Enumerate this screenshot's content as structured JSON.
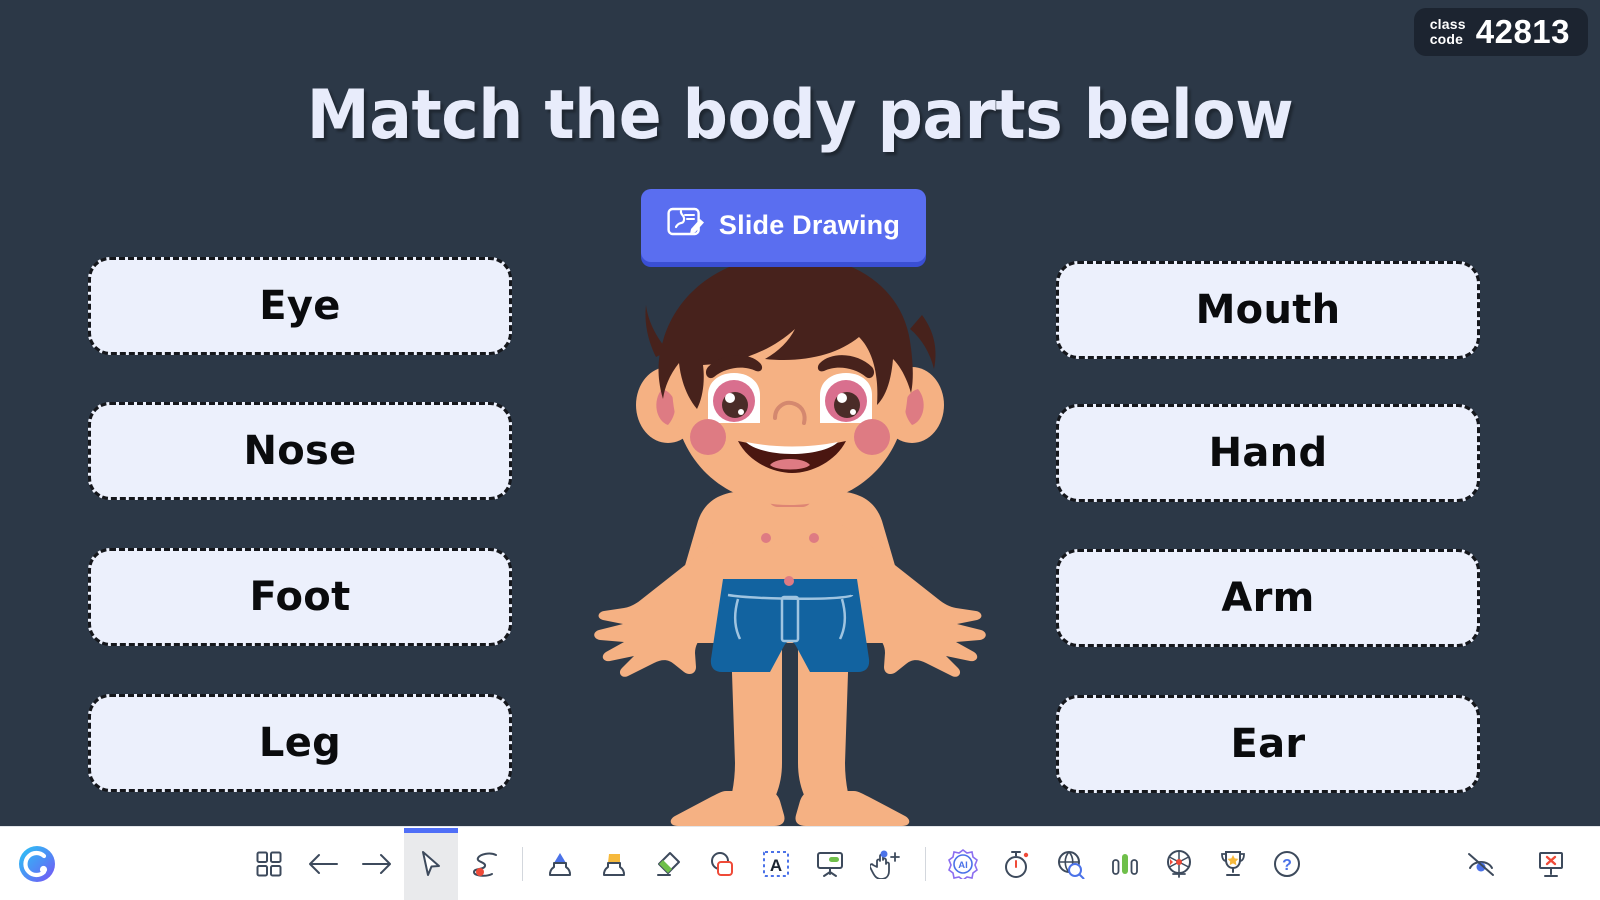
{
  "app": {
    "name": "ClassPoint",
    "background_color": "#2c3847",
    "accent_color": "#5a6ef0",
    "card_fill_color": "#ecf0fc",
    "toolbar_background": "#ffffff"
  },
  "class_code": {
    "label_line1": "class",
    "label_line2": "code",
    "value": "42813"
  },
  "slide": {
    "title": "Match the body parts below"
  },
  "slide_drawing_button": {
    "label": "Slide Drawing",
    "icon": "slide-drawing-icon"
  },
  "cards": {
    "left_column": [
      {
        "label": "Eye"
      },
      {
        "label": "Nose"
      },
      {
        "label": "Foot"
      },
      {
        "label": "Leg"
      }
    ],
    "right_column": [
      {
        "label": "Mouth"
      },
      {
        "label": "Hand"
      },
      {
        "label": "Arm"
      },
      {
        "label": "Ear"
      }
    ]
  },
  "illustration": {
    "name": "cartoon-boy-body",
    "skin_color": "#f5b183",
    "hair_color": "#47221c",
    "shorts_color": "#1263a0",
    "cheek_color": "#e0767f",
    "eye_color": "#d96f8e"
  },
  "toolbar": {
    "logo": "classpoint-logo",
    "tools": [
      {
        "name": "slide-grid-icon",
        "tooltip": "Slide Overview",
        "selected": false
      },
      {
        "name": "arrow-left-icon",
        "tooltip": "Previous Slide",
        "selected": false
      },
      {
        "name": "arrow-right-icon",
        "tooltip": "Next Slide",
        "selected": false
      },
      {
        "name": "cursor-icon",
        "tooltip": "Select",
        "selected": true
      },
      {
        "name": "laser-pointer-icon",
        "tooltip": "Laser Pointer",
        "selected": false
      },
      {
        "name": "pen-icon",
        "tooltip": "Pen",
        "selected": false
      },
      {
        "name": "highlighter-icon",
        "tooltip": "Highlighter",
        "selected": false
      },
      {
        "name": "eraser-icon",
        "tooltip": "Eraser",
        "selected": false
      },
      {
        "name": "shapes-icon",
        "tooltip": "Shapes",
        "selected": false
      },
      {
        "name": "text-box-icon",
        "tooltip": "Text Box",
        "selected": false
      },
      {
        "name": "whiteboard-icon",
        "tooltip": "Whiteboard",
        "selected": false
      },
      {
        "name": "drag-objects-icon",
        "tooltip": "Drag Objects",
        "selected": false
      },
      {
        "name": "ai-icon",
        "tooltip": "AI Assistant",
        "selected": false
      },
      {
        "name": "timer-icon",
        "tooltip": "Timer",
        "selected": false
      },
      {
        "name": "browser-icon",
        "tooltip": "Embedded Browser",
        "selected": false
      },
      {
        "name": "bar-chart-icon",
        "tooltip": "Quick Poll",
        "selected": false
      },
      {
        "name": "name-picker-icon",
        "tooltip": "Name Picker",
        "selected": false
      },
      {
        "name": "leaderboard-icon",
        "tooltip": "Leaderboard",
        "selected": false
      },
      {
        "name": "help-icon",
        "tooltip": "Help",
        "selected": false
      }
    ],
    "right_tools": [
      {
        "name": "hide-toolbar-icon",
        "tooltip": "Hide Toolbar"
      },
      {
        "name": "exit-presentation-icon",
        "tooltip": "Exit Presentation"
      }
    ]
  }
}
